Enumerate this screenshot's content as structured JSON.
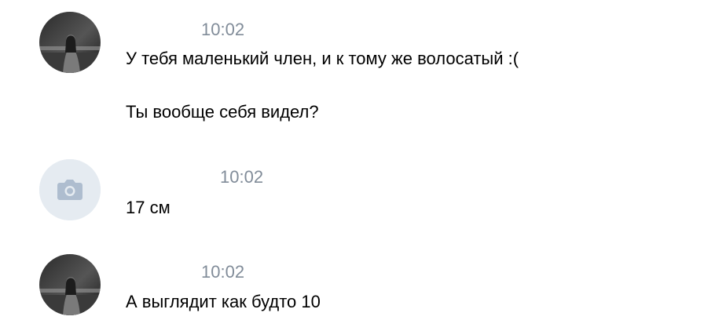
{
  "messages": [
    {
      "avatar": "user-photo-avatar",
      "time": "10:02",
      "lines": [
        "У тебя маленький член, и к тому же волосатый :(",
        "Ты вообще себя видел?"
      ]
    },
    {
      "avatar": "camera-placeholder-icon",
      "time": "10:02",
      "lines": [
        "17 см"
      ]
    },
    {
      "avatar": "user-photo-avatar",
      "time": "10:02",
      "lines": [
        "А выглядит как будто 10"
      ]
    }
  ],
  "colors": {
    "time": "#818c99",
    "text": "#000000",
    "placeholder_bg": "#e5ebf1",
    "placeholder_icon": "#aebdcf"
  }
}
